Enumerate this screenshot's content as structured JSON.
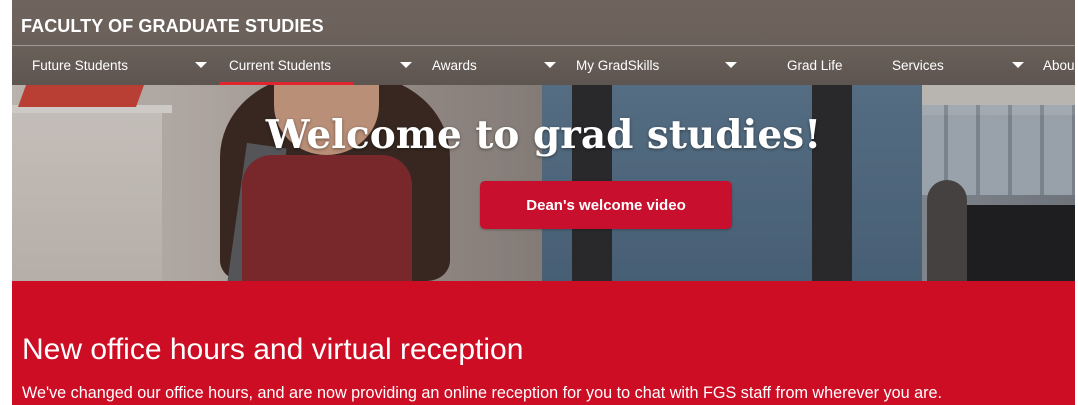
{
  "header": {
    "site_title": "FACULTY OF GRADUATE STUDIES"
  },
  "nav": {
    "items": [
      {
        "label": "Future Students",
        "has_dropdown": true,
        "active": false
      },
      {
        "label": "Current Students",
        "has_dropdown": true,
        "active": true
      },
      {
        "label": "Awards",
        "has_dropdown": true,
        "active": false
      },
      {
        "label": "My GradSkills",
        "has_dropdown": true,
        "active": false
      },
      {
        "label": "Grad Life",
        "has_dropdown": false,
        "active": false
      },
      {
        "label": "Services",
        "has_dropdown": true,
        "active": false
      },
      {
        "label": "Abou",
        "has_dropdown": false,
        "active": false
      }
    ]
  },
  "hero": {
    "title": "Welcome to grad studies!",
    "button_label": "Dean's welcome video"
  },
  "notice": {
    "heading": "New office hours and virtual reception",
    "text": "We've changed our office hours, and are now providing an online reception for you to chat with FGS staff from wherever you are."
  },
  "colors": {
    "header_bg": "#6a605a",
    "accent_red": "#cc0d24",
    "button_red": "#c8102e",
    "active_underline": "#e0252f"
  }
}
